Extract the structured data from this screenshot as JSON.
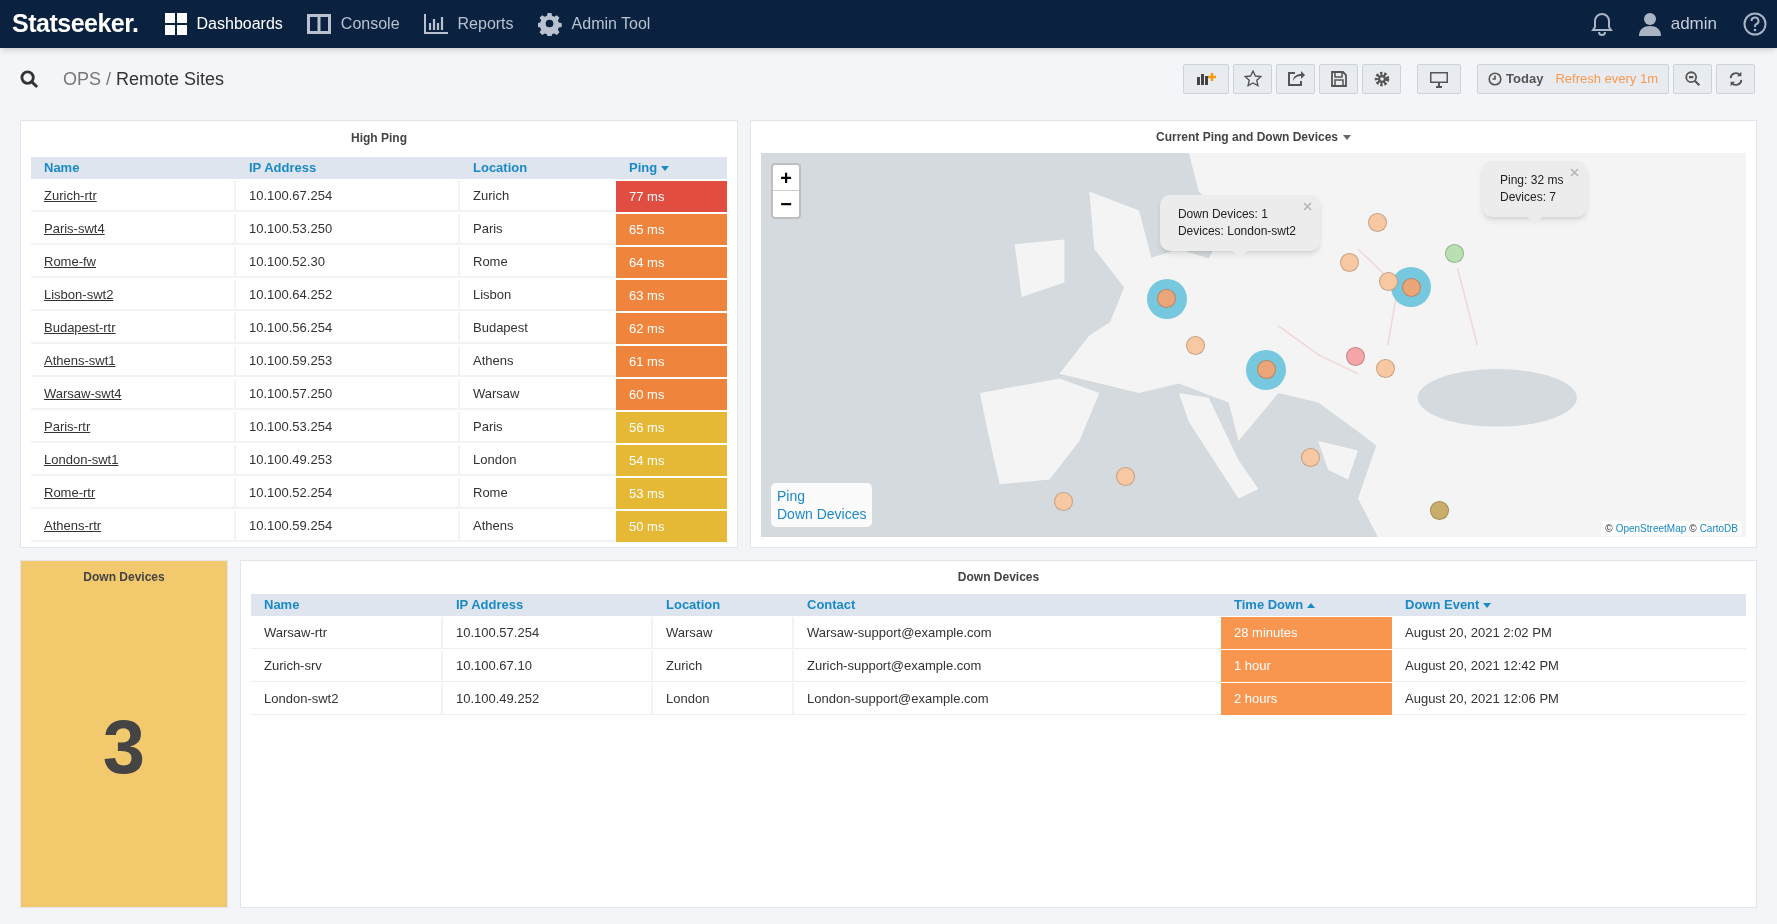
{
  "nav": {
    "logo": "Statseeker.",
    "items": [
      {
        "label": "Dashboards",
        "selected": true
      },
      {
        "label": "Console",
        "selected": false
      },
      {
        "label": "Reports",
        "selected": false
      },
      {
        "label": "Admin Tool",
        "selected": false
      }
    ],
    "user": "admin"
  },
  "breadcrumb": {
    "parent": "OPS",
    "separator": "/",
    "current": "Remote Sites"
  },
  "toolbar": {
    "time_range": "Today",
    "refresh": "Refresh every 1m"
  },
  "high_ping": {
    "title": "High Ping",
    "columns": [
      {
        "label": "Name",
        "sorted": false
      },
      {
        "label": "IP Address",
        "sorted": false
      },
      {
        "label": "Location",
        "sorted": false
      },
      {
        "label": "Ping",
        "sorted": true,
        "ascending": false
      }
    ],
    "rows": [
      {
        "name": "Zurich-rtr",
        "ip": "10.100.67.254",
        "location": "Zurich",
        "ping": "77 ms",
        "color": "#e24d42"
      },
      {
        "name": "Paris-swt4",
        "ip": "10.100.53.250",
        "location": "Paris",
        "ping": "65 ms",
        "color": "#ef843c"
      },
      {
        "name": "Rome-fw",
        "ip": "10.100.52.30",
        "location": "Rome",
        "ping": "64 ms",
        "color": "#ef843c"
      },
      {
        "name": "Lisbon-swt2",
        "ip": "10.100.64.252",
        "location": "Lisbon",
        "ping": "63 ms",
        "color": "#ef843c"
      },
      {
        "name": "Budapest-rtr",
        "ip": "10.100.56.254",
        "location": "Budapest",
        "ping": "62 ms",
        "color": "#ef843c"
      },
      {
        "name": "Athens-swt1",
        "ip": "10.100.59.253",
        "location": "Athens",
        "ping": "61 ms",
        "color": "#ef843c"
      },
      {
        "name": "Warsaw-swt4",
        "ip": "10.100.57.250",
        "location": "Warsaw",
        "ping": "60 ms",
        "color": "#ef843c"
      },
      {
        "name": "Paris-rtr",
        "ip": "10.100.53.254",
        "location": "Paris",
        "ping": "56 ms",
        "color": "#e5b835"
      },
      {
        "name": "London-swt1",
        "ip": "10.100.49.253",
        "location": "London",
        "ping": "54 ms",
        "color": "#e5b835"
      },
      {
        "name": "Rome-rtr",
        "ip": "10.100.52.254",
        "location": "Rome",
        "ping": "53 ms",
        "color": "#e5b835"
      },
      {
        "name": "Athens-rtr",
        "ip": "10.100.59.254",
        "location": "Athens",
        "ping": "50 ms",
        "color": "#e5b835"
      }
    ]
  },
  "map": {
    "title": "Current Ping and Down Devices",
    "kind": "picture",
    "markers": [
      {
        "kind": "down",
        "color": "#76c8de"
      },
      {
        "kind": "down",
        "color": "#76c8de"
      },
      {
        "kind": "down",
        "color": "#76c8de"
      },
      {
        "kind": "ping",
        "color": "#f8c8a3"
      },
      {
        "kind": "ping",
        "color": "#f8c8a3"
      },
      {
        "kind": "ping",
        "color": "#f8c8a3"
      },
      {
        "kind": "ping",
        "color": "#eaa679"
      },
      {
        "kind": "ping",
        "color": "#eaa679"
      },
      {
        "kind": "ping",
        "color": "#b9e0b0"
      },
      {
        "kind": "ping",
        "color": "#f8c8a3"
      },
      {
        "kind": "ping",
        "color": "#eaa679"
      },
      {
        "kind": "ping",
        "color": "#f5a5a8"
      },
      {
        "kind": "ping",
        "color": "#f8c8a3"
      },
      {
        "kind": "ping",
        "color": "#f8c8a3"
      },
      {
        "kind": "ping",
        "color": "#f8c8a3"
      },
      {
        "kind": "ping",
        "color": "#f8c8a3"
      },
      {
        "kind": "ping",
        "color": "#c8ae6a"
      }
    ],
    "popups": [
      {
        "lines": [
          "Down Devices: 1",
          "Devices: London-swt2"
        ]
      },
      {
        "lines": [
          "Ping: 32 ms",
          "Devices: 7"
        ]
      }
    ],
    "zoom": [
      "+",
      "−"
    ],
    "legend": [
      "Ping",
      "Down Devices"
    ],
    "attribution": {
      "prefix": "©",
      "links": [
        "OpenStreetMap",
        "CartoDB"
      ]
    }
  },
  "down_count": {
    "title": "Down Devices",
    "value": "3"
  },
  "down_devices": {
    "title": "Down Devices",
    "columns": [
      {
        "label": "Name",
        "sorted": false
      },
      {
        "label": "IP Address",
        "sorted": false
      },
      {
        "label": "Location",
        "sorted": false
      },
      {
        "label": "Contact",
        "sorted": false
      },
      {
        "label": "Time Down",
        "sorted": true,
        "ascending": true
      },
      {
        "label": "Down Event",
        "sorted": true,
        "ascending": false
      }
    ],
    "rows": [
      {
        "name": "Warsaw-rtr",
        "ip": "10.100.57.254",
        "location": "Warsaw",
        "contact": "Warsaw-support@example.com",
        "time_down": "28 minutes",
        "event": "August 20, 2021 2:02 PM"
      },
      {
        "name": "Zurich-srv",
        "ip": "10.100.67.10",
        "location": "Zurich",
        "contact": "Zurich-support@example.com",
        "time_down": "1 hour",
        "event": "August 20, 2021 12:42 PM"
      },
      {
        "name": "London-swt2",
        "ip": "10.100.49.252",
        "location": "London",
        "contact": "London-support@example.com",
        "time_down": "2 hours",
        "event": "August 20, 2021 12:06 PM"
      }
    ]
  }
}
